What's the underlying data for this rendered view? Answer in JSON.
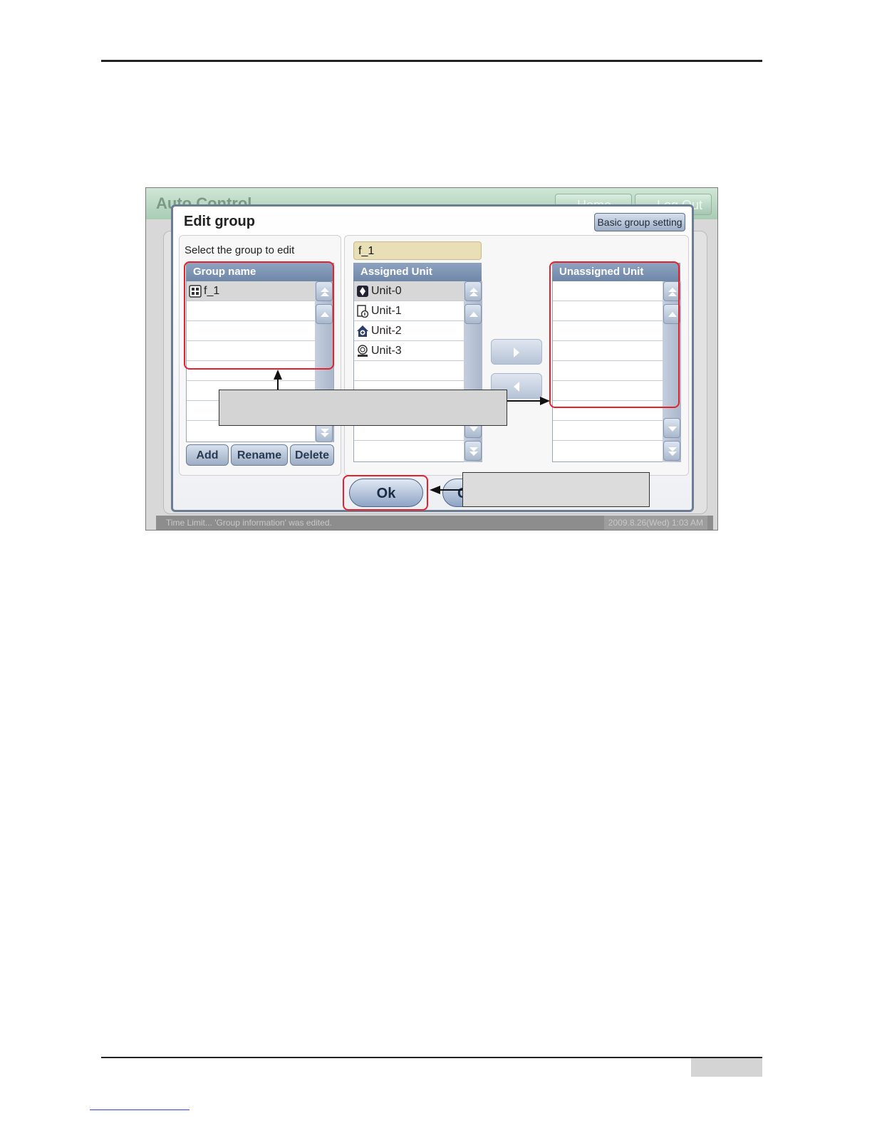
{
  "screen": {
    "app_title": "Auto Control",
    "home_label": "Home",
    "logout_label": "Log Out",
    "status_left": "Time Limit...  'Group information' was edited.",
    "status_right": "2009.8.26(Wed)  1:03 AM"
  },
  "dialog": {
    "title": "Edit group",
    "basic_group_setting": "Basic group setting",
    "select_label": "Select the group to edit",
    "group_list": {
      "header": "Group name",
      "items": [
        {
          "label": "f_1",
          "icon": "group-grid-icon"
        }
      ]
    },
    "selected_group_value": "f_1",
    "assigned": {
      "header": "Assigned Unit",
      "items": [
        {
          "label": "Unit-0",
          "icon": "indoor-unit-icon"
        },
        {
          "label": "Unit-1",
          "icon": "ventilator-icon"
        },
        {
          "label": "Unit-2",
          "icon": "home-unit-icon"
        },
        {
          "label": "Unit-3",
          "icon": "awhp-unit-icon"
        }
      ]
    },
    "unassigned": {
      "header": "Unassigned Unit",
      "items": []
    },
    "buttons": {
      "add": "Add",
      "rename": "Rename",
      "delete": "Delete",
      "ok": "Ok",
      "cancel": "C"
    }
  },
  "colors": {
    "annotation_red": "#e8202a",
    "list_header": "#7a90b0",
    "name_field": "#e9dfb7"
  }
}
